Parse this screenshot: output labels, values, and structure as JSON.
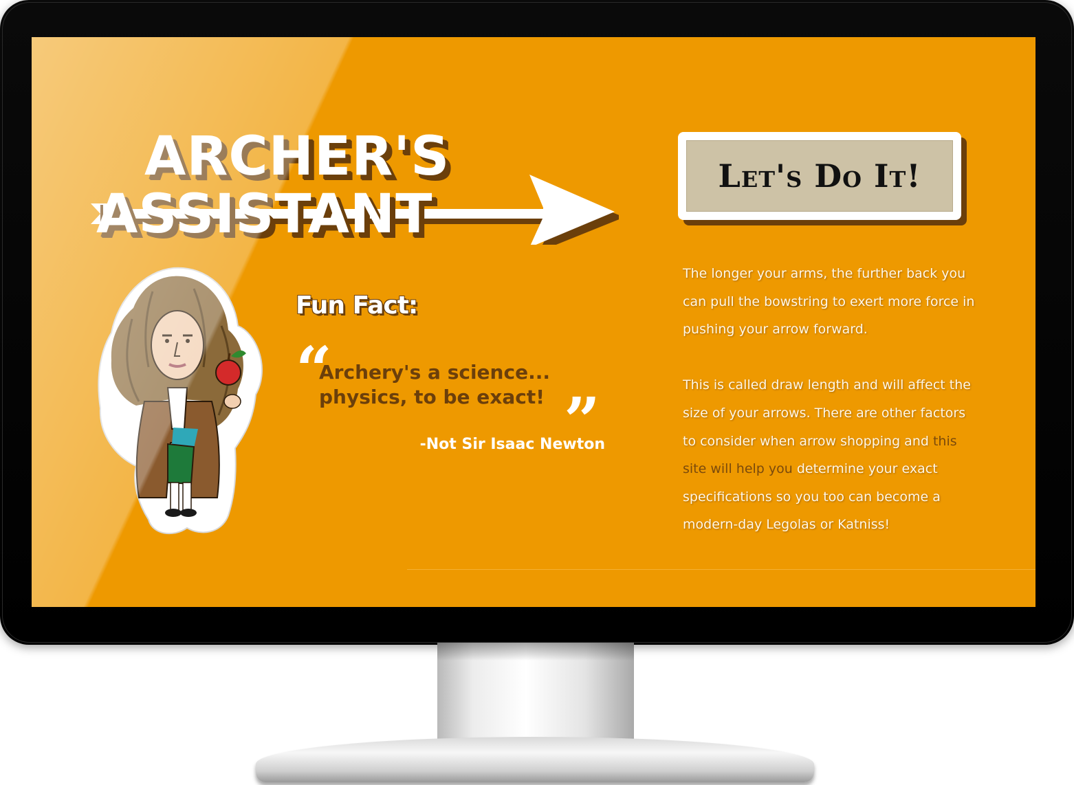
{
  "logo": {
    "line1": "ARCHER'S",
    "line2": "ASSISTANT"
  },
  "cta": {
    "label": "Let's Do It!"
  },
  "fun_fact": {
    "title": "Fun Fact:",
    "open_quote": "“",
    "close_quote": "”",
    "quote_line1": "Archery's a science...",
    "quote_line2": "physics, to be exact!",
    "author": "-Not Sir Isaac Newton"
  },
  "info": {
    "paragraph1": "The longer your arms, the further back you can pull the bowstring to exert more force in pushing your arrow forward.",
    "paragraph2_before": "This is called draw length and will affect the size of your arrows. There are other factors to consider when arrow shopping and ",
    "paragraph2_link": "this site will help you",
    "paragraph2_after": " determine your exact specifications so you too can become a modern-day Legolas or Katniss!"
  },
  "colors": {
    "background": "#ee9900",
    "accent_brown": "#6b3f0b",
    "button_face": "#cdc2a6"
  },
  "illustration": {
    "name": "isaac-newton-cartoon"
  }
}
